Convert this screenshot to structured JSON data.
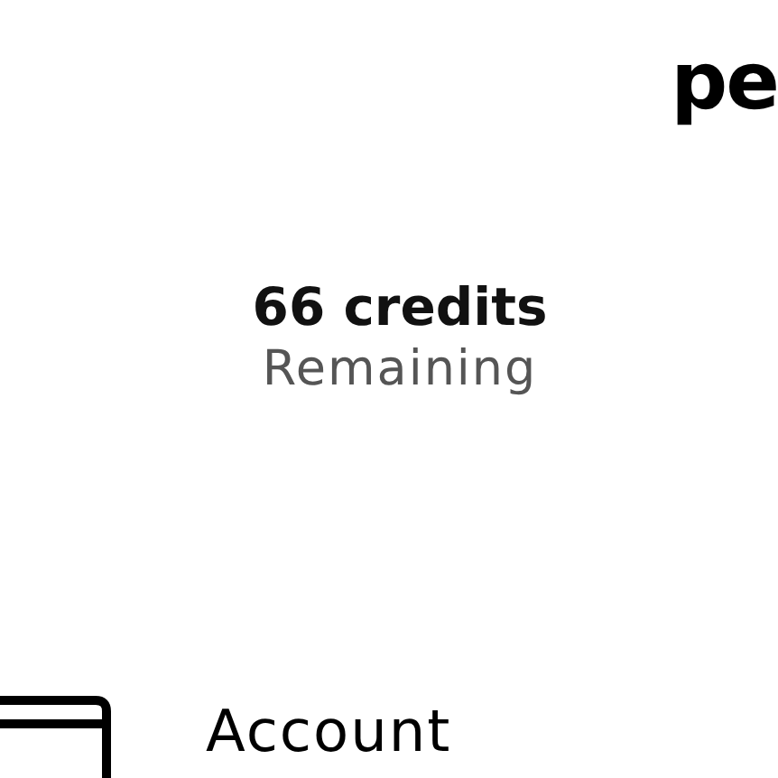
{
  "brand": "pe",
  "credits": {
    "amount": "66 credits",
    "caption": "Remaining"
  },
  "menu_item": {
    "label": "Account"
  }
}
